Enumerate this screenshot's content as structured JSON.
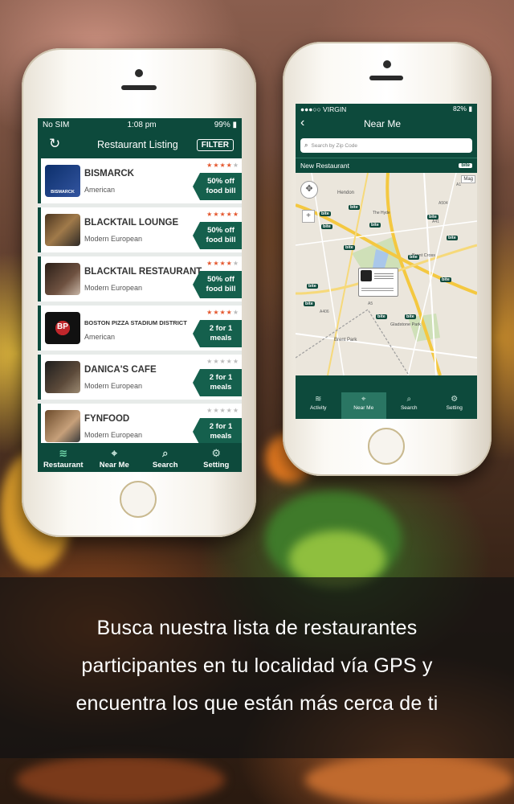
{
  "caption": {
    "line1": "Busca nuestra lista de restaurantes",
    "line2": "participantes  en tu localidad vía GPS  y",
    "line3": "encuentra los que están más cerca de ti"
  },
  "phone1": {
    "status": {
      "carrier": "No SIM",
      "time": "1:08 pm",
      "battery": "99%"
    },
    "nav": {
      "title": "Restaurant Listing",
      "filter_label": "FILTER"
    },
    "restaurants": [
      {
        "name": "BISMARCK",
        "cuisine": "American",
        "deal_line1": "50% off",
        "deal_line2": "food bill",
        "rating": 4
      },
      {
        "name": "BLACKTAIL LOUNGE",
        "cuisine": "Modern European",
        "deal_line1": "50% off",
        "deal_line2": "food bill",
        "rating": 5
      },
      {
        "name": "BLACKTAIL RESTAURANT",
        "cuisine": "Modern European",
        "deal_line1": "50% off",
        "deal_line2": "food bill",
        "rating": 4
      },
      {
        "name": "BOSTON PIZZA STADIUM DISTRICT",
        "cuisine": "American",
        "deal_line1": "2 for 1",
        "deal_line2": "meals",
        "rating": 4
      },
      {
        "name": "DANICA'S CAFE",
        "cuisine": "Modern European",
        "deal_line1": "2 for 1",
        "deal_line2": "meals",
        "rating": 0
      },
      {
        "name": "FYNFOOD",
        "cuisine": "Modern European",
        "deal_line1": "2 for 1",
        "deal_line2": "meals",
        "rating": 0
      }
    ],
    "thumb_texts": {
      "bismarck": "BISMARCK",
      "boston": "BP"
    },
    "tabs": [
      {
        "label": "Restaurant",
        "icon": "rss-icon"
      },
      {
        "label": "Near Me",
        "icon": "location-icon"
      },
      {
        "label": "Search",
        "icon": "search-icon"
      },
      {
        "label": "Setting",
        "icon": "gear-icon"
      }
    ]
  },
  "phone2": {
    "status": {
      "carrier": "●●●○○ VIRGIN",
      "battery": "82%"
    },
    "nav": {
      "title": "Near Me"
    },
    "search_placeholder": "Search by Zip Code",
    "section_label": "New Restaurant",
    "section_logo": "bite",
    "map_button": "Mag",
    "map_labels": {
      "hendon": "Hendon",
      "brent_cross": "Brent Cross",
      "brent_park": "Brent Park",
      "gladstone_park": "Gladstone Park",
      "the_hyde": "The Hyde",
      "road_a41": "A41",
      "road_a406": "A406",
      "road_a5": "A5",
      "road_a504": "A504",
      "road_a1": "A1"
    },
    "tabs": [
      {
        "label": "Activity",
        "icon": "rss-icon"
      },
      {
        "label": "Near Me",
        "icon": "location-icon"
      },
      {
        "label": "Search",
        "icon": "search-icon"
      },
      {
        "label": "Setting",
        "icon": "gear-icon"
      }
    ]
  },
  "colors": {
    "brand_green": "#0d4a3c",
    "deal_green": "#15604d",
    "star": "#e4572e"
  }
}
